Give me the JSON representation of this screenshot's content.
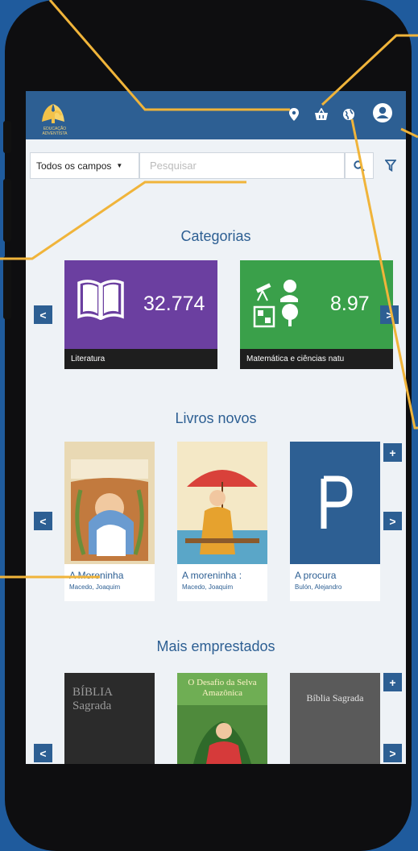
{
  "app": {
    "logo_text": "EDUCAÇÃO ADVENTISTA"
  },
  "search": {
    "field_selected": "Todos os campos",
    "placeholder": "Pesquisar"
  },
  "categories": {
    "title": "Categorias",
    "items": [
      {
        "count": "32.774",
        "label": "Literatura",
        "color": "#6b3fa0",
        "icon": "open-book-icon"
      },
      {
        "count": "8.97",
        "label": "Matemática e ciências natu",
        "color": "#3aa04a",
        "icon": "science-icon"
      }
    ]
  },
  "new_books": {
    "title": "Livros novos",
    "items": [
      {
        "title": "A Moreninha",
        "author": "Macedo, Joaquim"
      },
      {
        "title": "A moreninha :",
        "author": "Macedo, Joaquim"
      },
      {
        "title": "A procura",
        "author": "Bulón, Alejandro"
      }
    ]
  },
  "most_borrowed": {
    "title": "Mais emprestados",
    "items": [
      {
        "cover_text": "BÍBLIA Sagrada"
      },
      {
        "cover_text": "O Desafio da Selva Amazônica"
      },
      {
        "cover_text": "Bíblia Sagrada"
      }
    ]
  },
  "nav": {
    "prev": "<",
    "next": ">",
    "add": "+"
  },
  "colors": {
    "primary": "#2d5f93",
    "background": "#1f5b9d",
    "callout_line": "#f0b43a"
  },
  "icons": [
    "location-pin-icon",
    "basket-icon",
    "globe-icon",
    "user-account-icon",
    "search-icon",
    "filter-icon"
  ]
}
